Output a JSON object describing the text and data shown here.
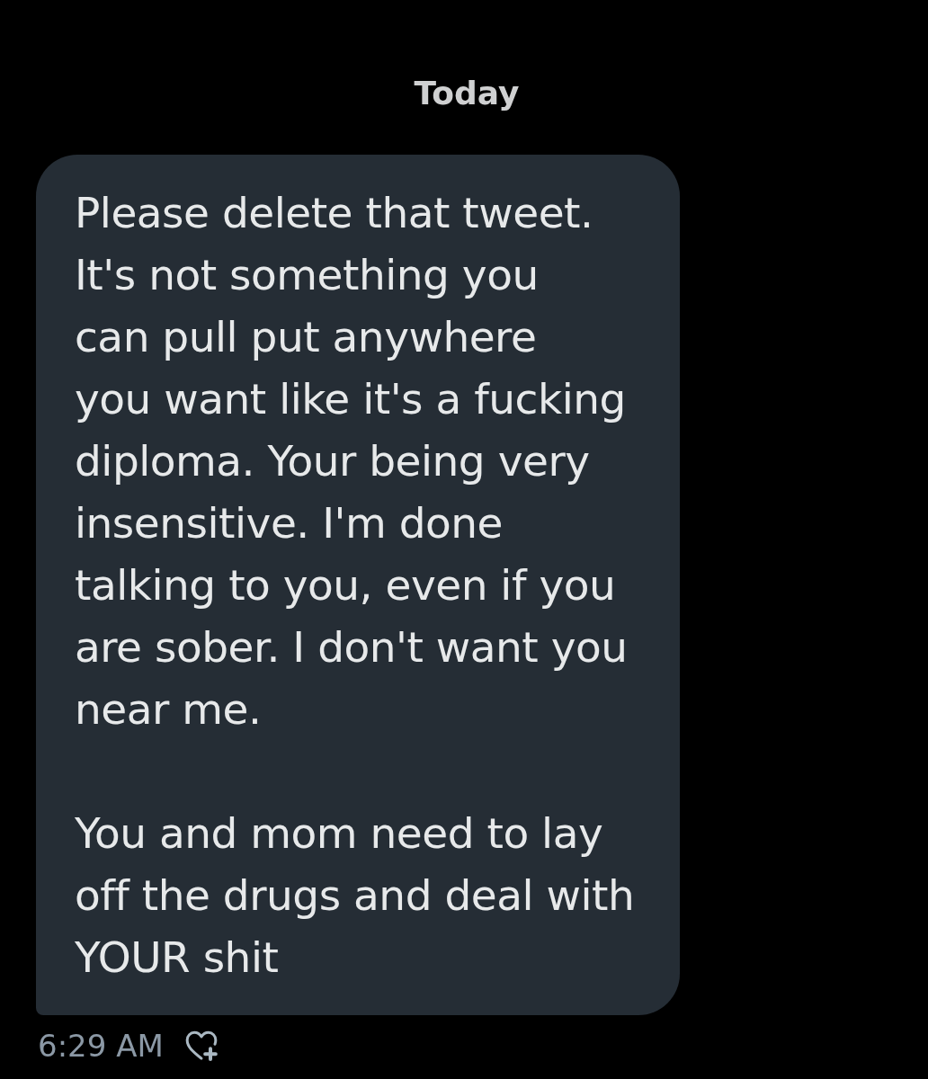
{
  "date_divider": "Today",
  "message": {
    "paragraphs": [
      "Please delete that tweet.\nIt's not something you\ncan pull put anywhere\nyou want like it's a fucking\ndiploma. Your being very\ninsensitive. I'm done\ntalking to you, even if you\nare sober. I don't want you\nnear me.",
      "You and mom need to lay\noff the drugs and deal with\nYOUR shit"
    ],
    "time": "6:29 AM"
  }
}
